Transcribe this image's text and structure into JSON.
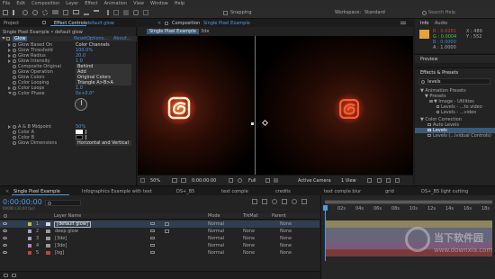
{
  "menubar": [
    "File",
    "Edit",
    "Composition",
    "Layer",
    "Effect",
    "Animation",
    "View",
    "Window",
    "Help"
  ],
  "toolbar": {
    "snapping": "Snapping",
    "workspace_label": "Workspace:",
    "workspace_value": "Standard",
    "search_placeholder": "Search Help"
  },
  "project_tab": "Project",
  "effect_controls": {
    "tab": "Effect Controls",
    "tab_layer": "default glow",
    "breadcrumb": "Single Pixel Example • default glow",
    "effect_name": "Glow",
    "reset": "Reset",
    "options": "Options...",
    "about": "About...",
    "props": [
      {
        "label": "Glow Based On",
        "value": "Color Channels"
      },
      {
        "label": "Glow Threshold",
        "value": "100.0%"
      },
      {
        "label": "Glow Radius",
        "value": "20.0"
      },
      {
        "label": "Glow Intensity",
        "value": "1.0"
      },
      {
        "label": "Composite Original",
        "value": "Behind"
      },
      {
        "label": "Glow Operation",
        "value": "Add"
      },
      {
        "label": "Glow Colors",
        "value": "Original Colors"
      },
      {
        "label": "Color Looping",
        "value": "Triangle A>B>A"
      },
      {
        "label": "Color Loops",
        "value": "1.0"
      },
      {
        "label": "Color Phase",
        "value": "0x+0.0°"
      }
    ],
    "props2": [
      {
        "label": "A & B Midpoint",
        "value": "50%"
      },
      {
        "label": "Color A",
        "value": ""
      },
      {
        "label": "Color B",
        "value": ""
      },
      {
        "label": "Glow Dimensions",
        "value": "Horizontal and Vertical"
      }
    ]
  },
  "composition": {
    "tab": "Composition",
    "tab_name": "Single Pixel Example",
    "sub_tab1": "Single Pixel Example",
    "sub_tab2": "3de",
    "zoom": "50%",
    "timecode": "0:00:00:00",
    "quality": "Full",
    "camera": "Active Camera",
    "views": "1 View"
  },
  "info_panel": {
    "tabs": [
      "Info",
      "Audio"
    ],
    "r": "R : 0.0261",
    "g": "G : 0.0004",
    "b": "B : 0.0000",
    "a": "A : 1.0000",
    "x": "X : 489",
    "y": "Y : 552"
  },
  "preview_tab": "Preview",
  "effects_presets": {
    "tab": "Effects & Presets",
    "search": "levels",
    "items": [
      {
        "label": "▼ Animation Presets",
        "indent": 0
      },
      {
        "label": "▼ Presets",
        "indent": 1
      },
      {
        "label": "▼ Image - Utilities",
        "indent": 2
      },
      {
        "label": "Levels - ...to video",
        "indent": 3
      },
      {
        "label": "Levels - ...video",
        "indent": 3
      },
      {
        "label": "▼ Color Correction",
        "indent": 0
      },
      {
        "label": "Auto Levels",
        "indent": 1
      },
      {
        "label": "Levels",
        "indent": 1,
        "selected": true
      },
      {
        "label": "Levels (...ividual Controls)",
        "indent": 1
      }
    ]
  },
  "timeline": {
    "tabs": [
      "Single Pixel Example",
      "Infographics Example with text",
      "DS+_B5",
      "text comple",
      "credits",
      "text comple blur",
      "grid",
      "DS+_B5 light cutting"
    ],
    "timecode": "0:00:00:00",
    "timecode_sub": "00000 (30.00 fps)",
    "col_layer": "Layer Name",
    "col_mode": "Mode",
    "col_trkmat": "TrkMat",
    "col_parent": "Parent",
    "layers": [
      {
        "num": "1",
        "name": "[default glow]",
        "mode": "Normal",
        "trkmat": "",
        "parent": "None",
        "color": "#c9b54e",
        "selected": true
      },
      {
        "num": "2",
        "name": "deep glow",
        "mode": "Normal",
        "trkmat": "None",
        "parent": "None",
        "color": "#a2a2c8"
      },
      {
        "num": "3",
        "name": "[3de]",
        "mode": "Normal",
        "trkmat": "None",
        "parent": "None",
        "color": "#a2a2c8"
      },
      {
        "num": "4",
        "name": "[3de]",
        "mode": "Normal",
        "trkmat": "None",
        "parent": "None",
        "color": "#c080c0"
      },
      {
        "num": "5",
        "name": "[bg]",
        "mode": "Normal",
        "trkmat": "None",
        "parent": "None",
        "color": "#c84040"
      }
    ],
    "ruler": [
      "",
      "02s",
      "04s",
      "06s",
      "08s",
      "10s",
      "12s",
      "14s",
      "16s",
      "18s"
    ]
  },
  "watermark": {
    "brand": "当下软件园",
    "url": "www.downxia.com"
  },
  "colors": {
    "accent": "#e7a43c",
    "panel": "#232323",
    "selection": "#3c5a78",
    "glow": "#ff3a1a",
    "swatch": "#e8a13a"
  }
}
